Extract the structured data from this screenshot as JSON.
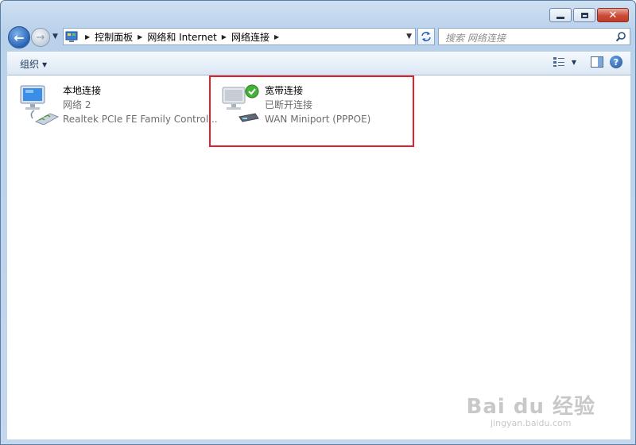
{
  "window": {
    "caption": {
      "minimize": "",
      "maximize": "",
      "close": "✕"
    }
  },
  "nav": {
    "breadcrumb": [
      "控制面板",
      "网络和 Internet",
      "网络连接"
    ],
    "search_placeholder": "搜索 网络连接"
  },
  "toolbar": {
    "organize_label": "组织"
  },
  "connections": [
    {
      "name": "本地连接",
      "status": "网络  2",
      "device": "Realtek PCIe FE Family Control..."
    },
    {
      "name": "宽带连接",
      "status": "已断开连接",
      "device": "WAN Miniport (PPPOE)"
    }
  ],
  "watermark": {
    "main": "Bai du 经验",
    "sub": "jingyan.baidu.com"
  },
  "colors": {
    "highlight": "#e0202a",
    "accent": "#2a64b8"
  }
}
